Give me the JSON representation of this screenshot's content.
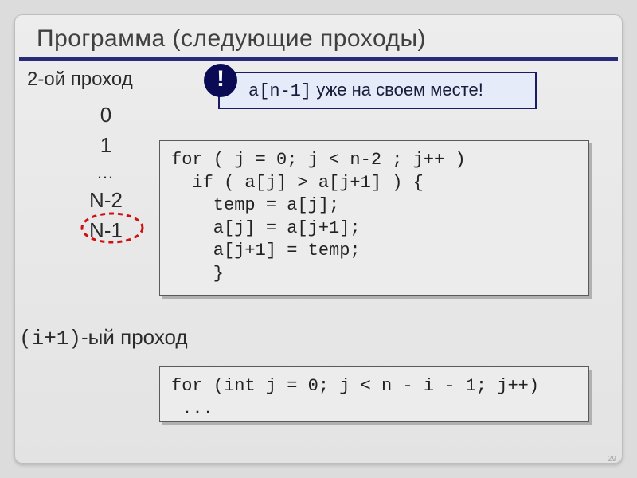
{
  "title": "Программа (следующие проходы)",
  "pass2": {
    "label": "2-ой проход"
  },
  "indices": {
    "i0": "0",
    "i1": "1",
    "dots": "…",
    "in2": "N-2",
    "in1": "N-1"
  },
  "callout": {
    "bang": "!",
    "code": "a[n-1]",
    "text_after": " уже на своем месте!"
  },
  "code1": "for ( j = 0; j < n-2 ; j++ )\n  if ( a[j] > a[j+1] ) {\n    temp = a[j];\n    a[j] = a[j+1];\n    a[j+1] = temp;\n    }",
  "ipass": {
    "code_prefix": "(i+1)",
    "label_suffix": "-ый проход"
  },
  "code2": "for (int j = 0; j < n - i - 1; j++)\n ...",
  "slide_number": "29"
}
